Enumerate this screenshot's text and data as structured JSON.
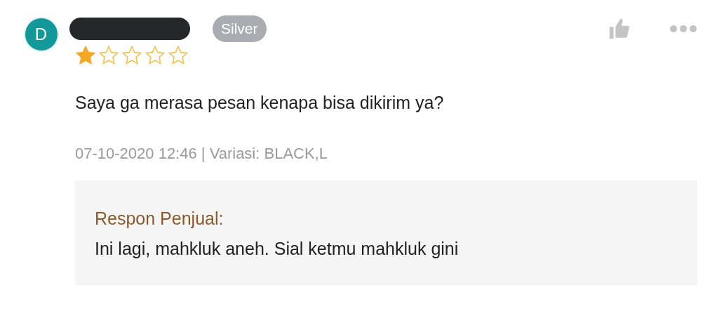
{
  "review": {
    "avatar_letter": "D",
    "badge": "Silver",
    "username_redacted": true,
    "stars": 1,
    "liked": false,
    "comment": "Saya ga merasa pesan kenapa bisa dikirim ya?",
    "meta": "07-10-2020 12:46 | Variasi: BLACK,L",
    "seller_reply": {
      "label": "Respon Penjual:",
      "text": "Ini lagi, mahkluk aneh. Sial ketmu mahkluk gini"
    }
  }
}
